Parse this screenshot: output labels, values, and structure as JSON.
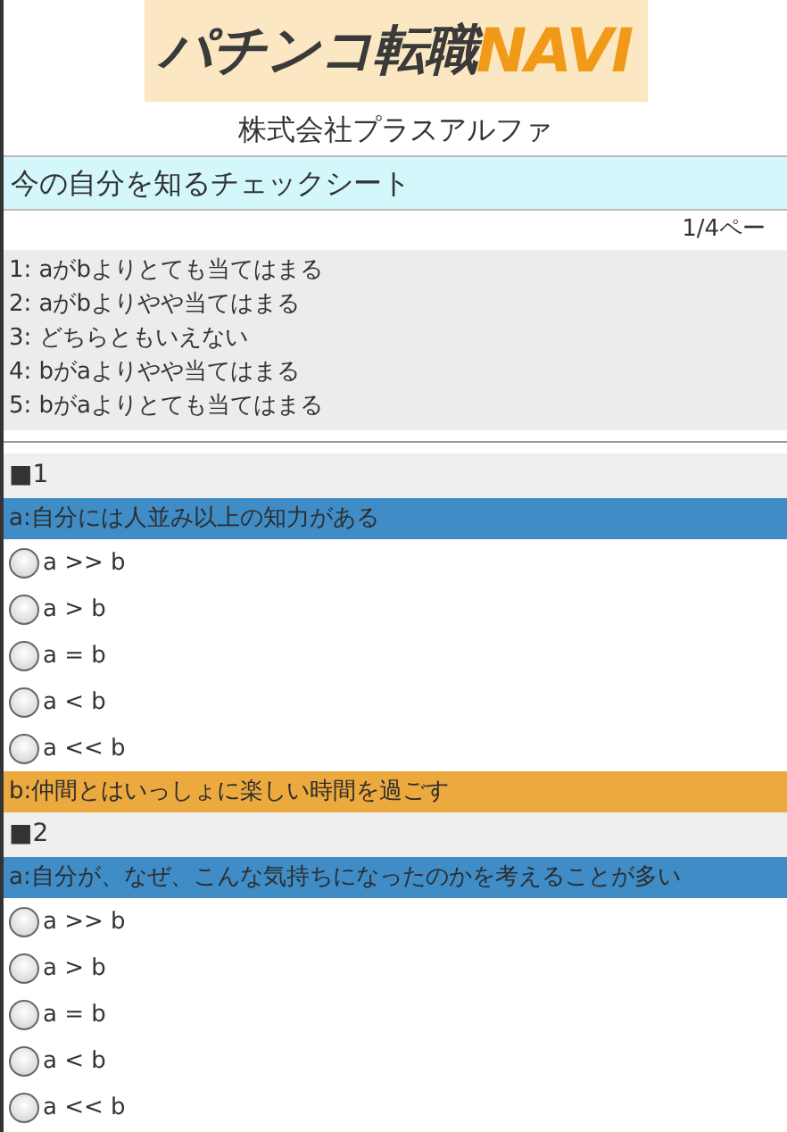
{
  "logo": {
    "text": "パチンコ転職",
    "accent": "NAVI"
  },
  "company": "株式会社プラスアルファ",
  "title": "今の自分を知るチェックシート",
  "page": "1/4ペー",
  "legend": [
    "1: aがbよりとても当てはまる",
    "2: aがbよりやや当てはまる",
    "3: どちらともいえない",
    "4: bがaよりやや当てはまる",
    "5: bがaよりとても当てはまる"
  ],
  "questions": [
    {
      "heading": "■1",
      "a": "a:自分には人並み以上の知力がある",
      "options": [
        {
          "label": "a >> b",
          "selected": false
        },
        {
          "label": "a > b",
          "selected": false
        },
        {
          "label": "a = b",
          "selected": false
        },
        {
          "label": "a < b",
          "selected": false
        },
        {
          "label": "a << b",
          "selected": false
        }
      ],
      "b": "b:仲間とはいっしょに楽しい時間を過ごす"
    },
    {
      "heading": "■2",
      "a": "a:自分が、なぜ、こんな気持ちになったのかを考えることが多い",
      "options": [
        {
          "label": "a >> b",
          "selected": false
        },
        {
          "label": "a > b",
          "selected": false
        },
        {
          "label": "a = b",
          "selected": false
        },
        {
          "label": "a < b",
          "selected": false
        },
        {
          "label": "a << b",
          "selected": false
        }
      ]
    }
  ]
}
